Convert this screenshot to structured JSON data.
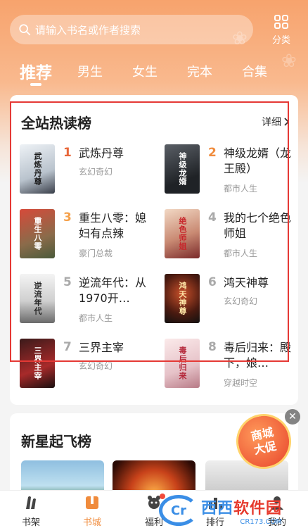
{
  "search": {
    "placeholder": "请输入书名或作者搜索"
  },
  "category_button": {
    "label": "分类",
    "icon": "grid-icon"
  },
  "tabs": [
    {
      "label": "推荐",
      "active": true
    },
    {
      "label": "男生"
    },
    {
      "label": "女生"
    },
    {
      "label": "完本"
    },
    {
      "label": "合集"
    }
  ],
  "hot": {
    "title": "全站热读榜",
    "more": "详细",
    "books": [
      {
        "rank": "1",
        "title": "武炼丹尊",
        "category": "玄幻奇幻",
        "cover_text": "武炼丹尊",
        "rank_color": "#e8673a"
      },
      {
        "rank": "2",
        "title": "神级龙婿（龙王殿）",
        "category": "都市人生",
        "cover_text": "神级龙婿",
        "rank_color": "#f08b3c"
      },
      {
        "rank": "3",
        "title": "重生八零：媳妇有点辣",
        "category": "豪门总裁",
        "cover_text": "重生八零",
        "rank_color": "#f5a04a"
      },
      {
        "rank": "4",
        "title": "我的七个绝色师姐",
        "category": "都市人生",
        "cover_text": "绝色师姐",
        "rank_color": "#aaaaaa"
      },
      {
        "rank": "5",
        "title": "逆流年代：从1970开…",
        "category": "都市人生",
        "cover_text": "逆流年代",
        "rank_color": "#aaaaaa"
      },
      {
        "rank": "6",
        "title": "鸿天神尊",
        "category": "玄幻奇幻",
        "cover_text": "鸿天神尊",
        "rank_color": "#aaaaaa"
      },
      {
        "rank": "7",
        "title": "三界主宰",
        "category": "玄幻奇幻",
        "cover_text": "三界主宰",
        "rank_color": "#aaaaaa"
      },
      {
        "rank": "8",
        "title": "毒后归来：殿下，娘…",
        "category": "穿越时空",
        "cover_text": "毒后归来",
        "rank_color": "#aaaaaa"
      }
    ]
  },
  "new_star": {
    "title": "新星起飞榜"
  },
  "promo": {
    "line1": "商城",
    "line2": "大促",
    "close": "✕"
  },
  "nav": [
    {
      "label": "书架",
      "icon": "bookshelf-icon"
    },
    {
      "label": "书城",
      "icon": "bookstore-icon",
      "active": true
    },
    {
      "label": "福利",
      "icon": "gift-icon"
    },
    {
      "label": "排行",
      "icon": "ranking-icon"
    },
    {
      "label": "我的",
      "icon": "profile-icon"
    }
  ],
  "watermark": {
    "logo": "Cr",
    "main_a": "西西",
    "main_b": "软件园",
    "sub": "CR173.COM"
  }
}
